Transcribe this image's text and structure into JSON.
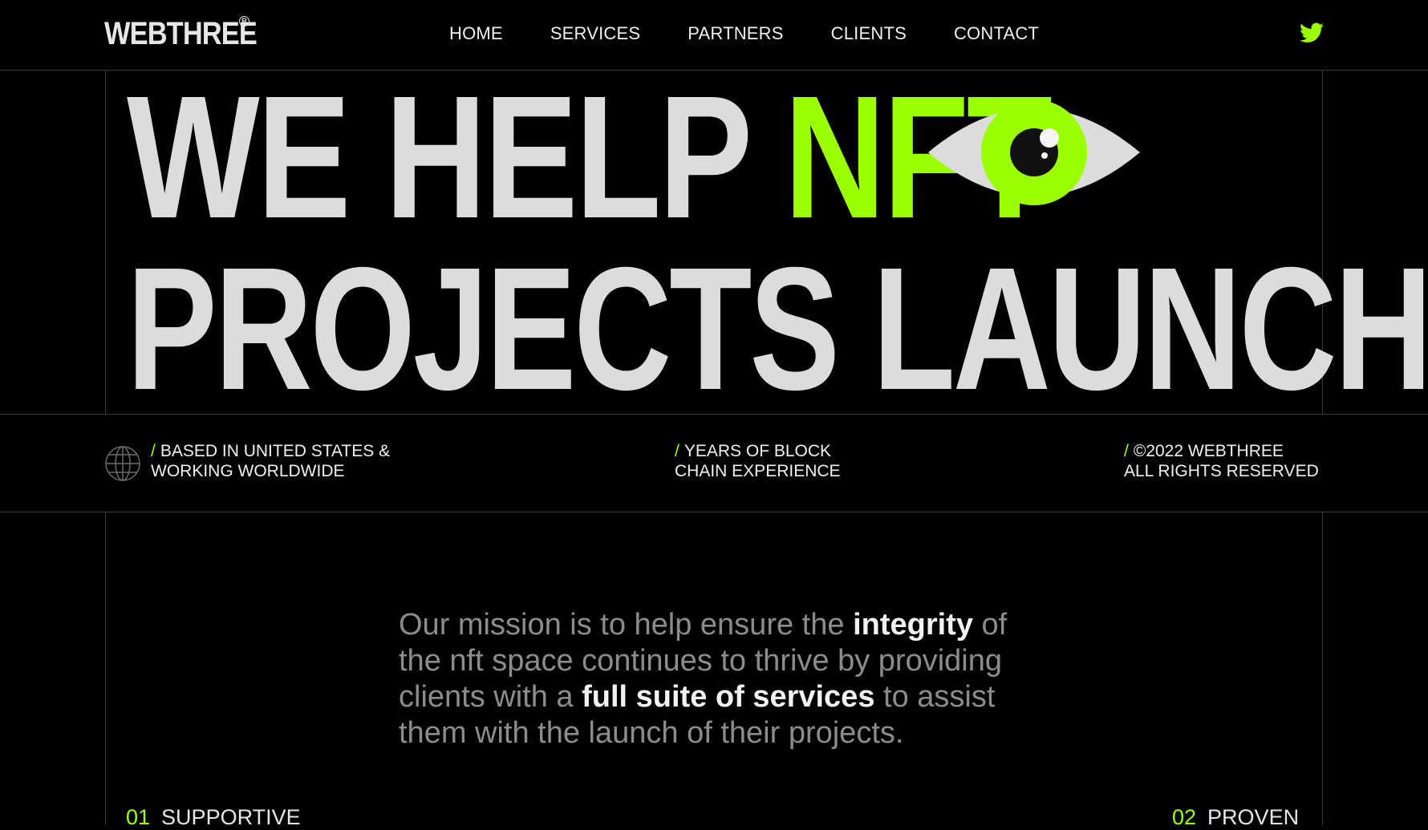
{
  "header": {
    "logo": "WEBTHREE",
    "logo_mark": "R",
    "nav": [
      "HOME",
      "SERVICES",
      "PARTNERS",
      "CLIENTS",
      "CONTACT"
    ],
    "social_icon": "twitter-icon"
  },
  "hero": {
    "line1_part1": "WE HELP ",
    "line1_accent": "NFT",
    "line2": "PROJECTS LAUNCH.",
    "illustration": "eye-icon"
  },
  "info": {
    "location_line1": "BASED IN UNITED STATES &",
    "location_line2": "WORKING WORLDWIDE",
    "experience_line1": "YEARS OF BLOCK",
    "experience_line2": "CHAIN EXPERIENCE",
    "copyright_line1": "©2022 WEBTHREE",
    "copyright_line2": "ALL RIGHTS RESERVED",
    "slash": "/",
    "globe_icon": "globe-icon"
  },
  "mission": {
    "part1": "Our mission is to help ensure the ",
    "bold1": "integrity",
    "part2": " of the nft space continues to thrive by providing clients with a ",
    "bold2": "full suite of services",
    "part3": " to assist them with the launch of their projects."
  },
  "features": [
    {
      "num": "01",
      "label": "SUPPORTIVE"
    },
    {
      "num": "02",
      "label": "PROVEN"
    }
  ],
  "colors": {
    "background": "#000000",
    "accent": "#9cff00",
    "text": "#dcdcdc",
    "muted": "#8c8c8c",
    "lines": "#3a3a3a"
  }
}
